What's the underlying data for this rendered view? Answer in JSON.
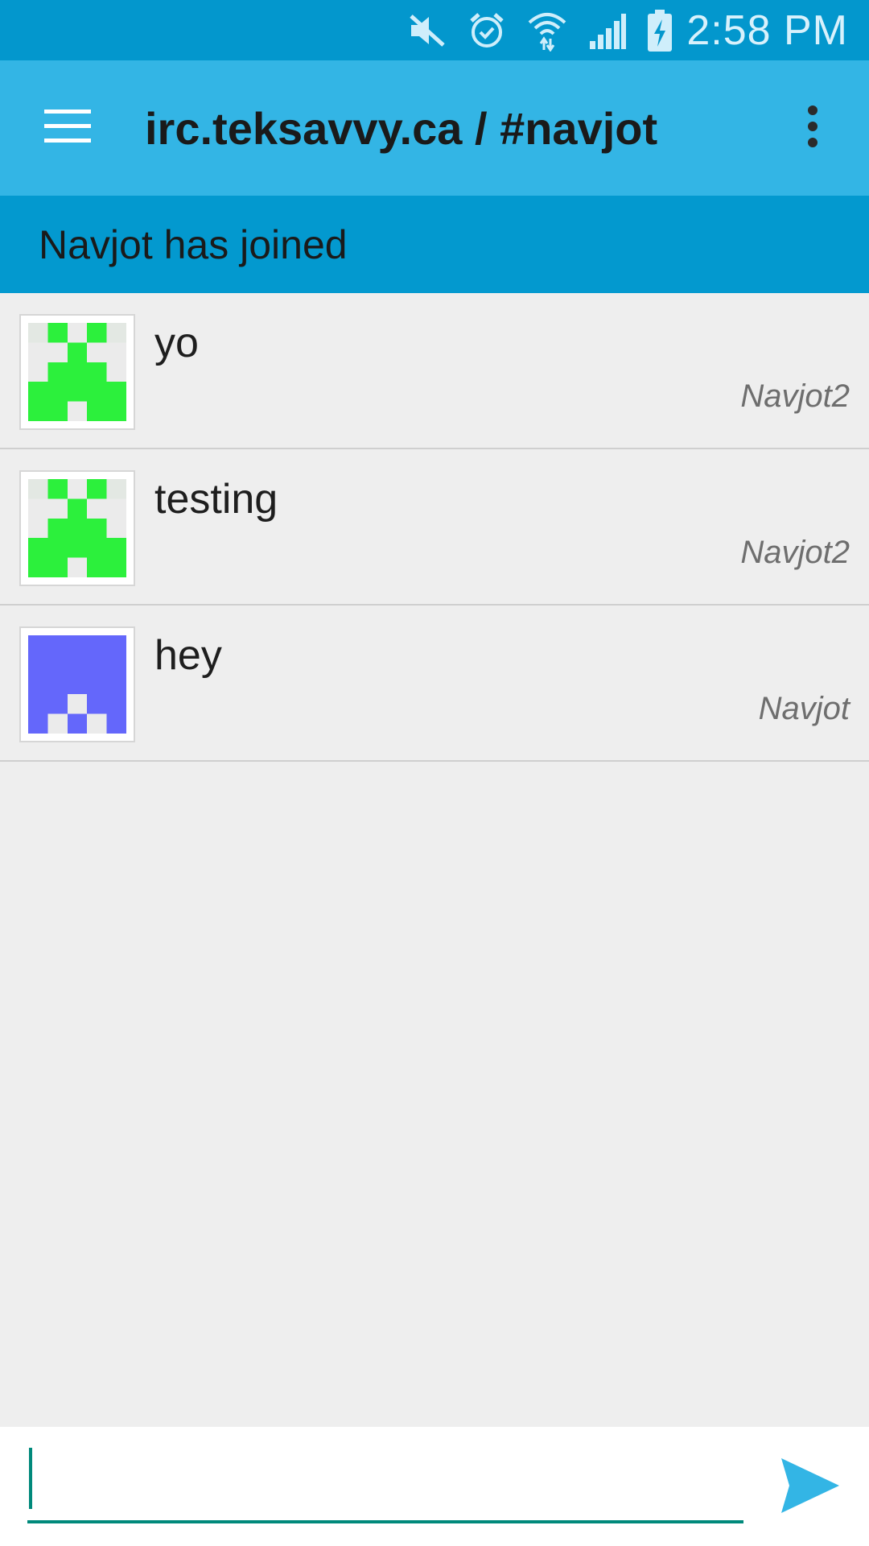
{
  "status_bar": {
    "time": "2:58 PM",
    "icons": [
      "mute-icon",
      "alarm-icon",
      "wifi-icon",
      "signal-icon",
      "battery-charging-icon"
    ]
  },
  "app_bar": {
    "title": "irc.teksavvy.ca / #navjot",
    "menu_icon": "hamburger-menu-icon",
    "overflow_icon": "more-vert-icon"
  },
  "event_banner": {
    "text": "Navjot has joined"
  },
  "messages": [
    {
      "text": "yo",
      "author": "Navjot2",
      "avatar_color": "#2cf03c"
    },
    {
      "text": "testing",
      "author": "Navjot2",
      "avatar_color": "#2cf03c"
    },
    {
      "text": "hey",
      "author": "Navjot",
      "avatar_color": "#6467fb"
    }
  ],
  "composer": {
    "input_value": "",
    "placeholder": "",
    "send_icon": "send-icon"
  },
  "colors": {
    "status_bar": "#0397cd",
    "app_bar": "#33b5e5",
    "banner": "#0399cf",
    "background": "#eeeeee",
    "accent": "#00897b",
    "send": "#33b5e5"
  }
}
